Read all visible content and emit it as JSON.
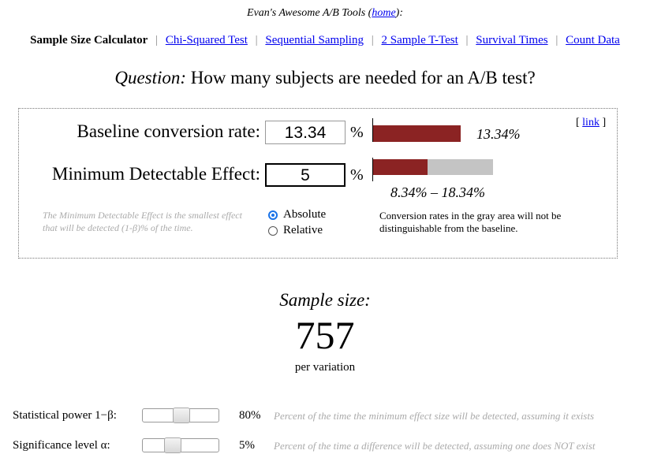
{
  "header": {
    "prefix": "Evan's Awesome A/B Tools (",
    "home_link": "home",
    "suffix": "):"
  },
  "nav": {
    "current": "Sample Size Calculator",
    "separator": "|",
    "links": [
      "Chi-Squared Test",
      "Sequential Sampling",
      "2 Sample T-Test",
      "Survival Times",
      "Count Data"
    ]
  },
  "question": {
    "label": "Question:",
    "text": " How many subjects are needed for an A/B test?"
  },
  "panel": {
    "baseline_label": "Baseline conversion rate:",
    "baseline_value": "13.34",
    "mde_label": "Minimum Detectable Effect:",
    "mde_value": "5",
    "percent_sign": "%",
    "baseline_bar_label": "13.34%",
    "baseline_rate": 0.1334,
    "mde_rate": 0.05,
    "range_label": "8.34% – 18.34%",
    "link_open": "[ ",
    "link_text": "link",
    "link_close": " ]",
    "hint_text": "The Minimum Detectable Effect is the smallest effect that will be detected (1-β)% of the time.",
    "mode_options": [
      "Absolute",
      "Relative"
    ],
    "mode_selected": "Absolute",
    "gray_note": "Conversion rates in the gray area will not be distinguishable from the baseline.",
    "colors": {
      "bar_red": "#8b2323",
      "bar_gray": "#c4c4c4"
    }
  },
  "result": {
    "title": "Sample size:",
    "value": "757",
    "unit": "per variation"
  },
  "params": [
    {
      "label": "Statistical power 1−β:",
      "value": "80%",
      "level": 0.5,
      "desc": "Percent of the time the minimum effect size will be detected, assuming it exists"
    },
    {
      "label": "Significance level α:",
      "value": "5%",
      "level": 0.35,
      "desc": "Percent of the time a difference will be detected, assuming one does NOT exist"
    }
  ]
}
